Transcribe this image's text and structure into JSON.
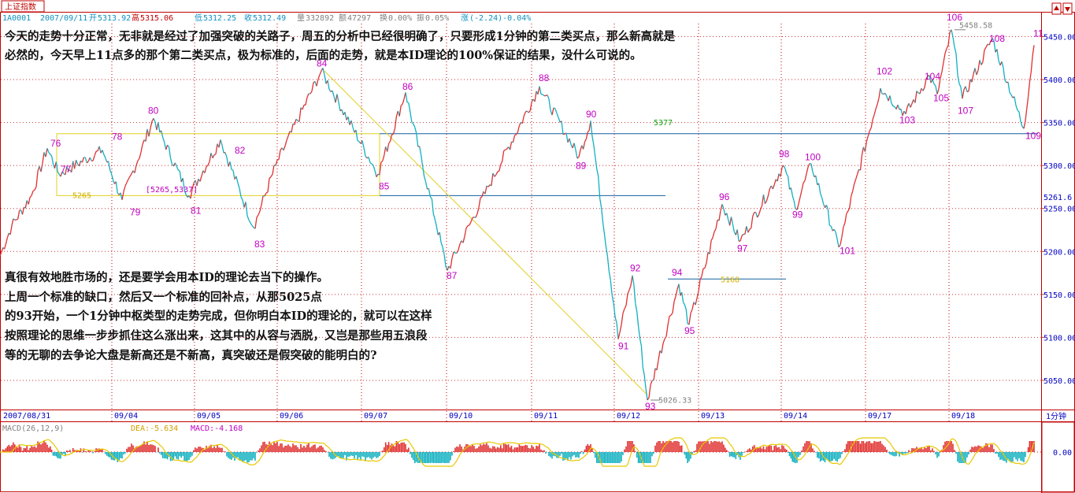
{
  "header": {
    "index_name": "上证指数",
    "code": "1A0001",
    "date": "2007/09/11",
    "open_label": "开",
    "open": "5313.92",
    "high_label": "高",
    "high": "5315.06",
    "low_label": "低",
    "low": "5312.25",
    "close_label": "收",
    "close": "5312.49",
    "volume_label": "量",
    "volume": "332892",
    "amount_label": "额",
    "amount": "47297",
    "turnover_label": "换",
    "turnover": "0.00%",
    "amplitude_label": "振",
    "amplitude": "0.05%",
    "change_label": "涨",
    "change": "(-2.24)-0.04%"
  },
  "notes": {
    "top_line1": "今天的走势十分正常，无非就是经过了加强突破的关路子，周五的分析中已经很明确了，只要形成1分钟的第二类买点，那么新高就是",
    "top_line2": "必然的，今天早上11点多的那个第二类买点，极为标准的，后面的走势，就是本ID理论的100%保证的结果，没什么可说的。",
    "mid_line1": "真很有效地胜市场的，还是要学会用本ID的理论去当下的操作。",
    "mid_line2": "上周一个标准的缺口，然后又一个标准的回补点，从那5025点",
    "mid_line3": "的93开始，一个1分钟中枢类型的走势完成，但你明白本ID的理论的，就可以在这样",
    "mid_line4": "按照理论的思维一步步抓住这么涨出来，这其中的从容与洒脱，又岂是那些用五浪段",
    "mid_line5": "等的无聊的去争论大盘是新高还是不新高，真突破还是假突破的能明白的?"
  },
  "chart_data": [
    {
      "type": "line",
      "title": "上证指数 1分钟",
      "period_label": "1分钟",
      "y_range": [
        5010,
        5475
      ],
      "y_ticks": [
        5050,
        5100,
        5150,
        5200,
        5250,
        5300,
        5350,
        5400,
        5450
      ],
      "y_tick_labels": [
        "5050.00",
        "5100.00",
        "5150.00",
        "5200.00",
        "5250.00",
        "5300.00",
        "5350.00",
        "5400.00",
        "5450.00"
      ],
      "current_price_label": "5261.6",
      "x_labels": [
        "2007/08/31",
        "09/04",
        "09/05",
        "09/06",
        "09/07",
        "09/10",
        "09/11",
        "09/12",
        "09/13",
        "09/14",
        "09/17",
        "09/18"
      ],
      "pivots": [
        {
          "t": 0,
          "v": 5195
        },
        {
          "t": 15,
          "v": 5230
        },
        {
          "t": 40,
          "v": 5265
        },
        {
          "t": 60,
          "v": 5320
        },
        {
          "t": 75,
          "v": 5290
        },
        {
          "t": 130,
          "v": 5318
        },
        {
          "t": 155,
          "v": 5260
        },
        {
          "t": 195,
          "v": 5355
        },
        {
          "t": 240,
          "v": 5265
        },
        {
          "t": 280,
          "v": 5330
        },
        {
          "t": 322,
          "v": 5228
        },
        {
          "t": 350,
          "v": 5300
        },
        {
          "t": 408,
          "v": 5410
        },
        {
          "t": 480,
          "v": 5290
        },
        {
          "t": 515,
          "v": 5385
        },
        {
          "t": 568,
          "v": 5178
        },
        {
          "t": 620,
          "v": 5275
        },
        {
          "t": 685,
          "v": 5392
        },
        {
          "t": 735,
          "v": 5310
        },
        {
          "t": 750,
          "v": 5352
        },
        {
          "t": 785,
          "v": 5098
        },
        {
          "t": 803,
          "v": 5172
        },
        {
          "t": 822,
          "v": 5027
        },
        {
          "t": 862,
          "v": 5162
        },
        {
          "t": 875,
          "v": 5115
        },
        {
          "t": 917,
          "v": 5255
        },
        {
          "t": 940,
          "v": 5212
        },
        {
          "t": 995,
          "v": 5300
        },
        {
          "t": 1010,
          "v": 5250
        },
        {
          "t": 1030,
          "v": 5302
        },
        {
          "t": 1065,
          "v": 5205
        },
        {
          "t": 1118,
          "v": 5390
        },
        {
          "t": 1150,
          "v": 5360
        },
        {
          "t": 1180,
          "v": 5405
        },
        {
          "t": 1190,
          "v": 5383
        },
        {
          "t": 1208,
          "v": 5458
        },
        {
          "t": 1222,
          "v": 5378
        },
        {
          "t": 1260,
          "v": 5448
        },
        {
          "t": 1300,
          "v": 5343
        },
        {
          "t": 1313,
          "v": 5440
        }
      ],
      "wave_labels": [
        {
          "text": "76",
          "t": 70,
          "v": 5322
        },
        {
          "text": "77",
          "t": 83,
          "v": 5292
        },
        {
          "text": "78",
          "t": 148,
          "v": 5330
        },
        {
          "text": "79",
          "t": 171,
          "v": 5242
        },
        {
          "text": "80",
          "t": 194,
          "v": 5360
        },
        {
          "text": "81",
          "t": 248,
          "v": 5244
        },
        {
          "text": "82",
          "t": 304,
          "v": 5314
        },
        {
          "text": "83",
          "t": 329,
          "v": 5205
        },
        {
          "text": "84",
          "t": 408,
          "v": 5415
        },
        {
          "text": "85",
          "t": 487,
          "v": 5272
        },
        {
          "text": "86",
          "t": 517,
          "v": 5388
        },
        {
          "text": "87",
          "t": 573,
          "v": 5168
        },
        {
          "text": "88",
          "t": 690,
          "v": 5398
        },
        {
          "text": "89",
          "t": 737,
          "v": 5296
        },
        {
          "text": "90",
          "t": 750,
          "v": 5356
        },
        {
          "text": "91",
          "t": 791,
          "v": 5086
        },
        {
          "text": "92",
          "t": 806,
          "v": 5177
        },
        {
          "text": "93",
          "t": 825,
          "v": 5016
        },
        {
          "text": "94",
          "t": 859,
          "v": 5172
        },
        {
          "text": "95",
          "t": 875,
          "v": 5104
        },
        {
          "text": "96",
          "t": 919,
          "v": 5260
        },
        {
          "text": "97",
          "t": 942,
          "v": 5200
        },
        {
          "text": "98",
          "t": 995,
          "v": 5310
        },
        {
          "text": "99",
          "t": 1012,
          "v": 5239
        },
        {
          "text": "100",
          "t": 1028,
          "v": 5306
        },
        {
          "text": "101",
          "t": 1072,
          "v": 5197
        },
        {
          "text": "102",
          "t": 1119,
          "v": 5406
        },
        {
          "text": "103",
          "t": 1148,
          "v": 5349
        },
        {
          "text": "104",
          "t": 1180,
          "v": 5400
        },
        {
          "text": "105",
          "t": 1191,
          "v": 5375
        },
        {
          "text": "106",
          "t": 1208,
          "v": 5469
        },
        {
          "text": "107",
          "t": 1222,
          "v": 5360
        },
        {
          "text": "108",
          "t": 1262,
          "v": 5444
        },
        {
          "text": "109",
          "t": 1308,
          "v": 5331
        },
        {
          "text": "11",
          "t": 1318,
          "v": 5450
        }
      ],
      "annotations": [
        {
          "text": "[5265,5337]",
          "t": 185,
          "v": 5269
        },
        {
          "text": "5265",
          "t": 92,
          "v": 5262
        },
        {
          "text": "5377",
          "t": 830,
          "v": 5347
        },
        {
          "text": "5168",
          "t": 915,
          "v": 5164
        },
        {
          "text": "5458.58",
          "t": 1218,
          "v": 5460
        },
        {
          "text": "5026.33",
          "t": 836,
          "v": 5024
        }
      ],
      "levels": [
        {
          "name": "5337",
          "v": 5337
        },
        {
          "name": "5265",
          "v": 5265
        },
        {
          "name": "5168",
          "v": 5168
        }
      ],
      "zone": {
        "v_top": 5337,
        "v_bottom": 5265
      }
    },
    {
      "type": "bar",
      "title": "MACD(26,12,9)",
      "indicator_name": "MACD(26,12,9)",
      "dea_label": "DEA:-5.634",
      "macd_label": "MACD:-4.168",
      "zero_label": "0.00",
      "dea_value": -5.634,
      "macd_value": -4.168
    }
  ],
  "colors": {
    "background": "#ffffff",
    "up": "#e03030",
    "down": "#10b0c0",
    "grid": "#cc3333",
    "zone": "#e0d020",
    "level": "#1060a0",
    "wave": "#c000c0",
    "axis_text": "#0000c0"
  }
}
